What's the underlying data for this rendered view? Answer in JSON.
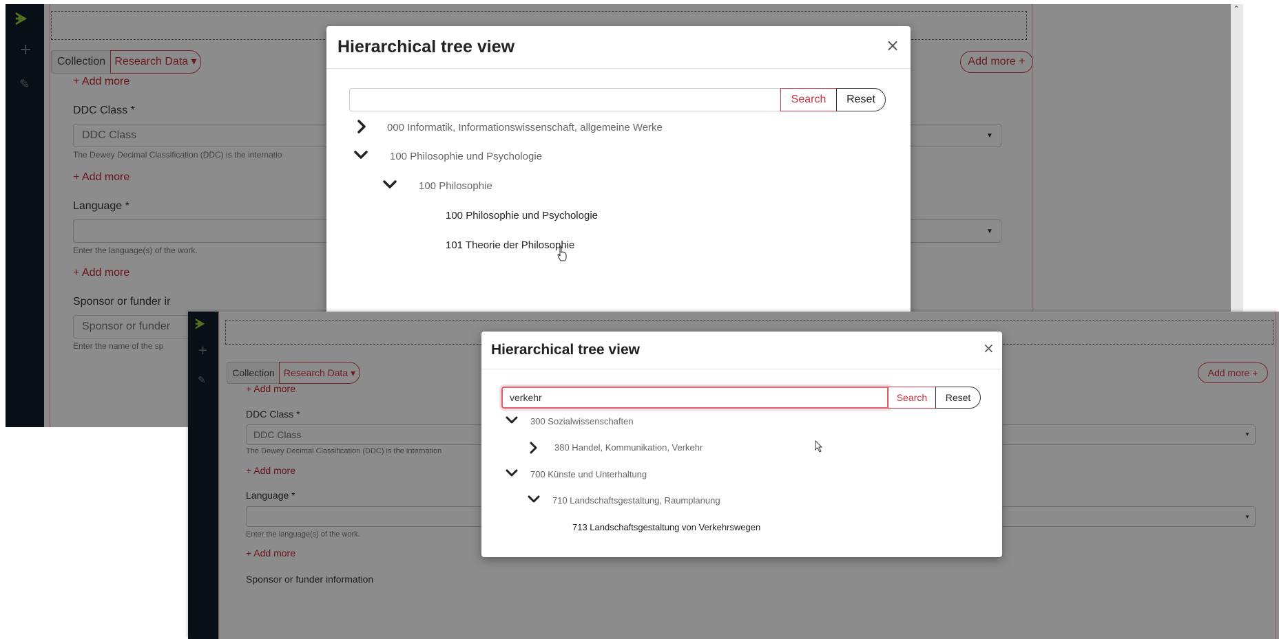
{
  "shot1": {
    "logo": "ᗘ",
    "sidebar_icons": [
      "+",
      "✎"
    ],
    "tabs": {
      "collection": "Collection",
      "research": "Research Data ▾"
    },
    "add_more_pill": "Add more +",
    "add_more_link": "+ Add more",
    "ddc_label": "DDC Class *",
    "ddc_placeholder": "DDC Class",
    "ddc_help": "The Dewey Decimal Classification (DDC) is the internatio",
    "language_label": "Language *",
    "language_help": "Enter the language(s) of the work.",
    "sponsor_label": "Sponsor or funder ir",
    "sponsor_placeholder": "Sponsor or funder",
    "sponsor_help": "Enter the name of the sp",
    "scroll_up": "⌃",
    "modal": {
      "title": "Hierarchical tree view",
      "close": "×",
      "search_value": "",
      "search_button": "Search",
      "reset_button": "Reset",
      "tree": [
        {
          "label": "000 Informatik, Informationswissenschaft, allgemeine Werke",
          "state": "collapsed"
        },
        {
          "label": "100 Philosophie und Psychologie",
          "state": "expanded"
        },
        {
          "label": "100 Philosophie",
          "state": "expanded"
        },
        {
          "label": "100 Philosophie und Psychologie",
          "state": "leaf"
        },
        {
          "label": "101 Theorie der Philosophie",
          "state": "leaf"
        }
      ]
    }
  },
  "shot2": {
    "logo": "ᗘ",
    "sidebar_icons": [
      "+",
      "✎"
    ],
    "tabs": {
      "collection": "Collection",
      "research": "Research Data ▾"
    },
    "add_more_pill": "Add more +",
    "add_more_link": "+ Add more",
    "ddc_label": "DDC Class *",
    "ddc_placeholder": "DDC Class",
    "ddc_help": "The Dewey Decimal Classification (DDC) is the internation",
    "language_label": "Language *",
    "language_help": "Enter the language(s) of the work.",
    "sponsor_label": "Sponsor or funder information",
    "modal": {
      "title": "Hierarchical tree view",
      "close": "×",
      "search_value": "verkehr",
      "search_button": "Search",
      "reset_button": "Reset",
      "tree": [
        {
          "label": "300 Sozialwissenschaften",
          "state": "expanded"
        },
        {
          "label": "380 Handel, Kommunikation, Verkehr",
          "state": "collapsed"
        },
        {
          "label": "700 Künste und Unterhaltung",
          "state": "expanded"
        },
        {
          "label": "710 Landschaftsgestaltung, Raumplanung",
          "state": "expanded"
        },
        {
          "label": "713 Landschaftsgestaltung von Verkehrswegen",
          "state": "leaf"
        }
      ]
    }
  },
  "colors": {
    "accent": "#c93040",
    "sidebar": "#0f1c2a",
    "logo": "#9bd03c"
  }
}
